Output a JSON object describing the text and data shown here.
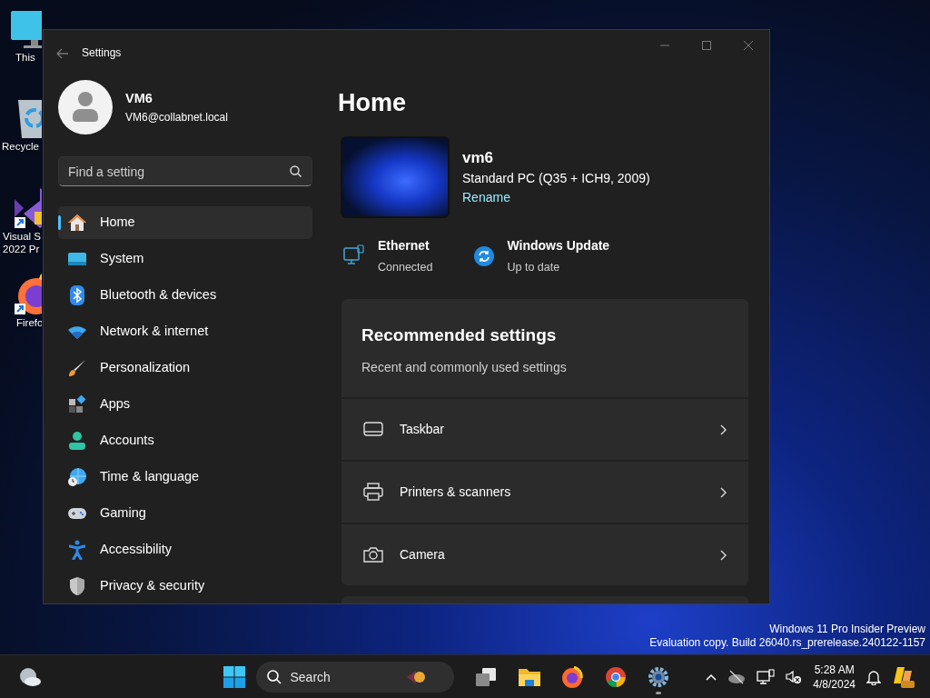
{
  "desktop_icons": [
    {
      "kind": "monitor",
      "lines": [
        "This"
      ]
    },
    {
      "kind": "recycle",
      "lines": [
        "Recycle"
      ]
    },
    {
      "kind": "studio",
      "lines": [
        "Visual S",
        "2022 Pr"
      ]
    },
    {
      "kind": "firefox",
      "lines": [
        "Firefo"
      ]
    }
  ],
  "window": {
    "title": "Settings"
  },
  "user": {
    "name": "VM6",
    "email": "VM6@collabnet.local"
  },
  "search": {
    "placeholder": "Find a setting"
  },
  "sidebar": {
    "items": [
      {
        "label": "Home",
        "selected": true
      },
      {
        "label": "System",
        "selected": false
      },
      {
        "label": "Bluetooth & devices",
        "selected": false
      },
      {
        "label": "Network & internet",
        "selected": false
      },
      {
        "label": "Personalization",
        "selected": false
      },
      {
        "label": "Apps",
        "selected": false
      },
      {
        "label": "Accounts",
        "selected": false
      },
      {
        "label": "Time & language",
        "selected": false
      },
      {
        "label": "Gaming",
        "selected": false
      },
      {
        "label": "Accessibility",
        "selected": false
      },
      {
        "label": "Privacy & security",
        "selected": false
      }
    ]
  },
  "page_title": "Home",
  "device": {
    "name": "vm6",
    "model": "Standard PC (Q35 + ICH9, 2009)",
    "link": "Rename"
  },
  "status": [
    {
      "kind": "ethernet",
      "title": "Ethernet",
      "subtitle": "Connected"
    },
    {
      "kind": "update",
      "title": "Windows Update",
      "subtitle": "Up to date"
    }
  ],
  "recommended": {
    "title": "Recommended settings",
    "subtitle": "Recent and commonly used settings",
    "items": [
      {
        "kind": "taskbar",
        "label": "Taskbar"
      },
      {
        "kind": "printer",
        "label": "Printers & scanners"
      },
      {
        "kind": "camera",
        "label": "Camera"
      }
    ]
  },
  "watermark": [
    "Windows 11 Pro Insider Preview",
    "Evaluation copy. Build 26040.rs_prerelease.240122-1157"
  ],
  "taskbar": {
    "search_placeholder": "Search",
    "apps": [
      {
        "kind": "taskview",
        "running": false
      },
      {
        "kind": "folder",
        "running": false
      },
      {
        "kind": "firefox",
        "running": false
      },
      {
        "kind": "chrome",
        "running": false
      },
      {
        "kind": "gear",
        "running": true
      }
    ],
    "time": "5:28 AM",
    "date": "4/8/2024"
  }
}
